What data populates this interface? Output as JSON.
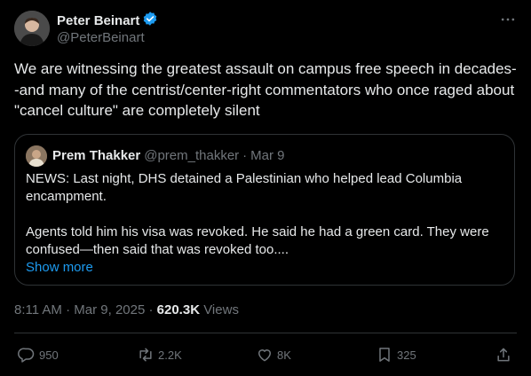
{
  "author": {
    "name": "Peter Beinart",
    "handle": "@PeterBeinart"
  },
  "tweet": {
    "text": "We are witnessing the greatest assault on campus free speech in decades--and many of the centrist/center-right commentators who once raged about \"cancel culture\" are completely silent"
  },
  "quote": {
    "name": "Prem Thakker",
    "handle": "@prem_thakker",
    "separator": "·",
    "date": "Mar 9",
    "paragraph1": "NEWS: Last night, DHS detained a Palestinian who helped lead Columbia encampment.",
    "paragraph2": "Agents told him his visa was revoked. He said he had a green card. They were confused—then said that was revoked too....",
    "show_more": "Show more"
  },
  "meta": {
    "time": "8:11 AM",
    "separator": "·",
    "date": "Mar 9, 2025",
    "views_count": "620.3K",
    "views_label": "Views"
  },
  "actions": {
    "replies": "950",
    "reposts": "2.2K",
    "likes": "8K",
    "bookmarks": "325"
  },
  "colors": {
    "background": "#000000",
    "text": "#e7e9ea",
    "secondary": "#71767b",
    "accent": "#1d9bf0",
    "border": "#2f3336"
  },
  "icons": [
    "verified-badge-icon",
    "more-icon",
    "reply-icon",
    "repost-icon",
    "like-icon",
    "bookmark-icon",
    "share-icon"
  ]
}
